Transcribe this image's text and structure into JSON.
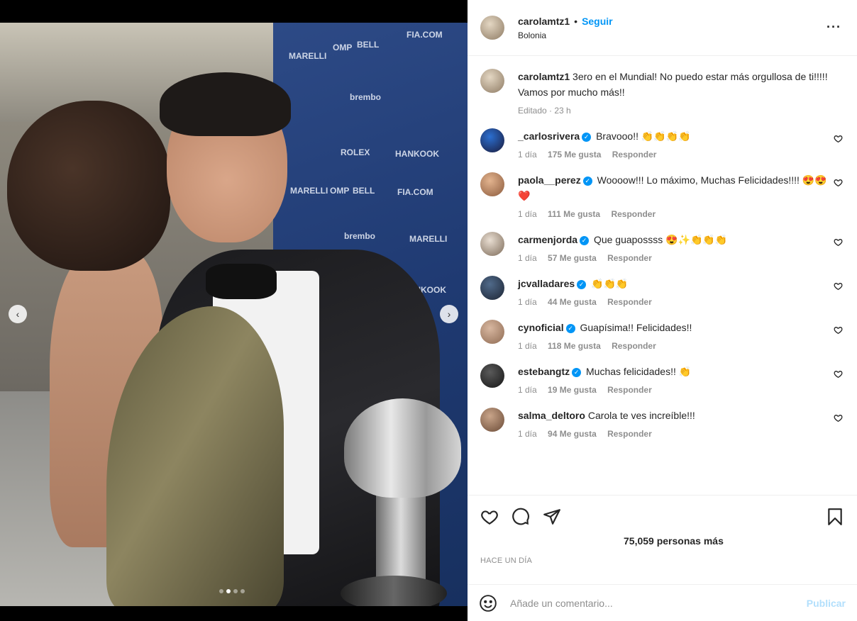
{
  "post": {
    "author": "carolamtz1",
    "separator": "•",
    "follow_label": "Seguir",
    "location": "Bolonia",
    "more_icon": "more-horizontal-icon"
  },
  "media": {
    "prev_icon": "chevron-left-icon",
    "next_icon": "chevron-right-icon",
    "backdrop_texts": [
      "FIA.COM",
      "OMP",
      "BELL",
      "MARELLI",
      "brembo",
      "HANKOOK",
      "ROLEX",
      "FIA.COM",
      "OMP",
      "BELL",
      "MARELLI",
      "brembo",
      "MARELLI",
      "HANKOOK"
    ],
    "carousel_dots": 4,
    "carousel_active": 2
  },
  "caption": {
    "username": "carolamtz1",
    "text": "3ero en el Mundial! No puedo estar más orgullosa de ti!!!!! Vamos por mucho más!!",
    "time": "Editado · 23 h"
  },
  "comments": [
    {
      "user": "_carlosrivera",
      "verified": true,
      "text": "Bravooo!! 👏👏👏👏",
      "time": "1 día",
      "likes": "175 Me gusta",
      "reply": "Responder"
    },
    {
      "user": "paola__perez",
      "verified": true,
      "text": "Woooow!!! Lo máximo, Muchas Felicidades!!!! 😍😍❤️",
      "time": "1 día",
      "likes": "111 Me gusta",
      "reply": "Responder"
    },
    {
      "user": "carmenjorda",
      "verified": true,
      "text": "Que guapossss 😍✨👏👏👏",
      "time": "1 día",
      "likes": "57 Me gusta",
      "reply": "Responder"
    },
    {
      "user": "jcvalladares",
      "verified": true,
      "text": "👏👏👏",
      "time": "1 día",
      "likes": "44 Me gusta",
      "reply": "Responder"
    },
    {
      "user": "cynoficial",
      "verified": true,
      "text": "Guapísima!! Felicidades!!",
      "time": "1 día",
      "likes": "118 Me gusta",
      "reply": "Responder"
    },
    {
      "user": "estebangtz",
      "verified": true,
      "text": "Muchas felicidades!! 👏",
      "time": "1 día",
      "likes": "19 Me gusta",
      "reply": "Responder"
    },
    {
      "user": "salma_deltoro",
      "verified": false,
      "text": "Carola te ves increíble!!!",
      "time": "1 día",
      "likes": "94 Me gusta",
      "reply": "Responder"
    }
  ],
  "actions": {
    "like_icon": "heart-icon",
    "comment_icon": "comment-bubble-icon",
    "share_icon": "paper-plane-icon",
    "save_icon": "bookmark-icon",
    "likes_text": "75,059 personas más",
    "posted": "HACE UN DÍA"
  },
  "composer": {
    "emoji_icon": "emoji-smile-icon",
    "placeholder": "Añade un comentario...",
    "publish_label": "Publicar"
  },
  "colors": {
    "accent": "#0095f6",
    "publish_disabled": "#b2dffc",
    "muted": "#8e8e8e",
    "text": "#262626"
  }
}
